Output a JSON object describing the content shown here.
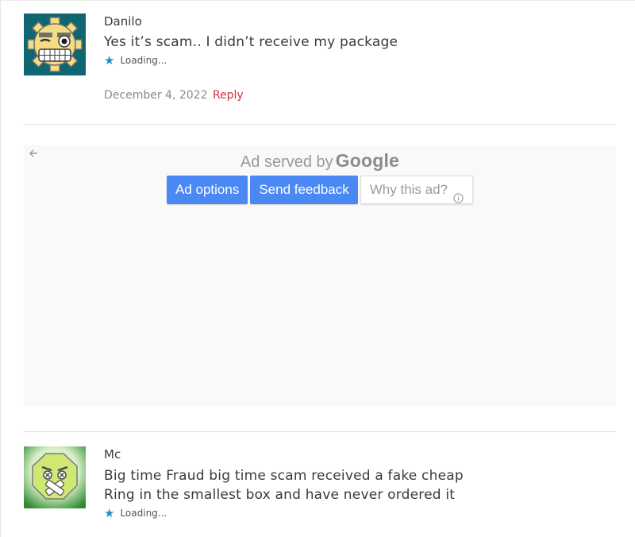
{
  "comments": [
    {
      "author": "Danilo",
      "text": "Yes it’s scam.. I didn’t receive my package",
      "rating_icon": "star-icon",
      "rating_text": "Loading...",
      "date": "December 4, 2022",
      "reply_label": "Reply"
    },
    {
      "author": "Mc",
      "text_line1": "Big time Fraud big time scam received a fake cheap",
      "text_line2": "Ring in the smallest box and have never ordered it",
      "rating_icon": "star-icon",
      "rating_text": "Loading..."
    }
  ],
  "ad": {
    "served_by": "Ad served by",
    "brand": "Google",
    "ad_options_label": "Ad options",
    "send_feedback_label": "Send feedback",
    "why_this_ad_label": "Why this ad?"
  },
  "colors": {
    "reply_link": "#d2303a",
    "star": "#1e8fcc",
    "ad_button": "#4a89f3",
    "ad_background": "#f9f9f9"
  }
}
